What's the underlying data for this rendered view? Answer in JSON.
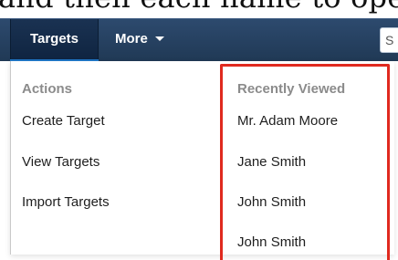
{
  "caption": {
    "text": "and then each name to ope"
  },
  "navbar": {
    "tabs": [
      {
        "label": "Targets"
      },
      {
        "label": "More"
      }
    ],
    "search_text": "S"
  },
  "dropdown": {
    "actions_title": "Actions",
    "actions": [
      {
        "label": "Create Target"
      },
      {
        "label": "View Targets"
      },
      {
        "label": "Import Targets"
      }
    ],
    "recent_title": "Recently Viewed",
    "recent": [
      {
        "label": "Mr. Adam Moore"
      },
      {
        "label": "Jane Smith"
      },
      {
        "label": "John Smith"
      },
      {
        "label": "John Smith"
      }
    ]
  },
  "colors": {
    "navbar": "#203955",
    "active_tab": "#0f2440",
    "active_underline": "#1f77c7",
    "highlight_border": "#e02a1f",
    "section_title": "#8b8b8b"
  },
  "icons": {
    "more_caret": "caret-down-icon"
  }
}
